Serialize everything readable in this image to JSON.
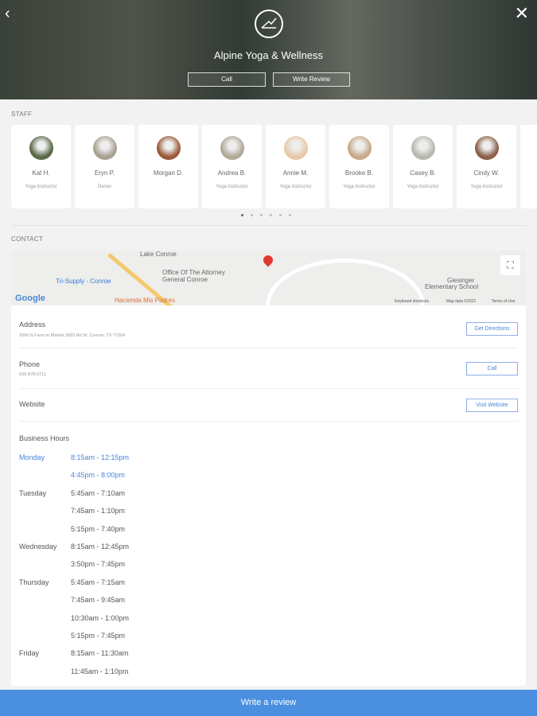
{
  "header": {
    "title": "Alpine Yoga & Wellness",
    "call_label": "Call",
    "write_review_label": "Write Review",
    "back_icon": "chevron-left-icon",
    "close_icon": "close-icon"
  },
  "staff": {
    "section_label": "STAFF",
    "members": [
      {
        "name": "Kat H.",
        "role": "Yoga Instructor",
        "color": "#5a6a48"
      },
      {
        "name": "Eryn P.",
        "role": "Owner",
        "color": "#a8a090"
      },
      {
        "name": "Morgan D.",
        "role": "",
        "color": "#9a5a3a"
      },
      {
        "name": "Andrea B.",
        "role": "Yoga Instructor",
        "color": "#b0a898"
      },
      {
        "name": "Annie M.",
        "role": "Yoga Instructor",
        "color": "#e8c8a8"
      },
      {
        "name": "Brooke B.",
        "role": "Yoga Instructor",
        "color": "#c8a888"
      },
      {
        "name": "Casey B.",
        "role": "Yoga Instructor",
        "color": "#b8b8b0"
      },
      {
        "name": "Cindy W.",
        "role": "Yoga Instructor",
        "color": "#8a6048"
      }
    ],
    "page_count": 6,
    "active_page": 0
  },
  "contact": {
    "section_label": "CONTACT",
    "map": {
      "labels": [
        "Lake Conroe",
        "Office Of The Attorney",
        "General Conroe",
        "Tri-Supply - Conroe",
        "Hacienda Mis Padres",
        "Giesinger",
        "Elementary School",
        "Google",
        "Keyboard shortcuts",
        "Map data ©2022",
        "Terms of Use"
      ]
    },
    "address": {
      "label": "Address",
      "value": "2066 N Farm to Market 3083 Rd W, Conroe, TX 77304",
      "button": "Get Directions"
    },
    "phone": {
      "label": "Phone",
      "value": "936-878-0711",
      "button": "Call"
    },
    "website": {
      "label": "Website",
      "button": "Visit Website"
    }
  },
  "hours": {
    "title": "Business Hours",
    "days": [
      {
        "day": "Monday",
        "times": [
          "8:15am - 12:15pm",
          "4:45pm - 8:00pm"
        ],
        "highlight": true
      },
      {
        "day": "Tuesday",
        "times": [
          "5:45am - 7:10am",
          "7:45am - 1:10pm",
          "5:15pm - 7:40pm"
        ]
      },
      {
        "day": "Wednesday",
        "times": [
          "8:15am - 12:45pm",
          "3:50pm - 7:45pm"
        ]
      },
      {
        "day": "Thursday",
        "times": [
          "5:45am - 7:15am",
          "7:45am - 9:45am",
          "10:30am - 1:00pm",
          "5:15pm - 7:45pm"
        ]
      },
      {
        "day": "Friday",
        "times": [
          "8:15am - 11:30am",
          "11:45am - 1:10pm"
        ]
      }
    ]
  },
  "footer": {
    "write_review": "Write a review"
  },
  "colors": {
    "accent": "#4a8fe0",
    "link": "#4a86d8"
  }
}
